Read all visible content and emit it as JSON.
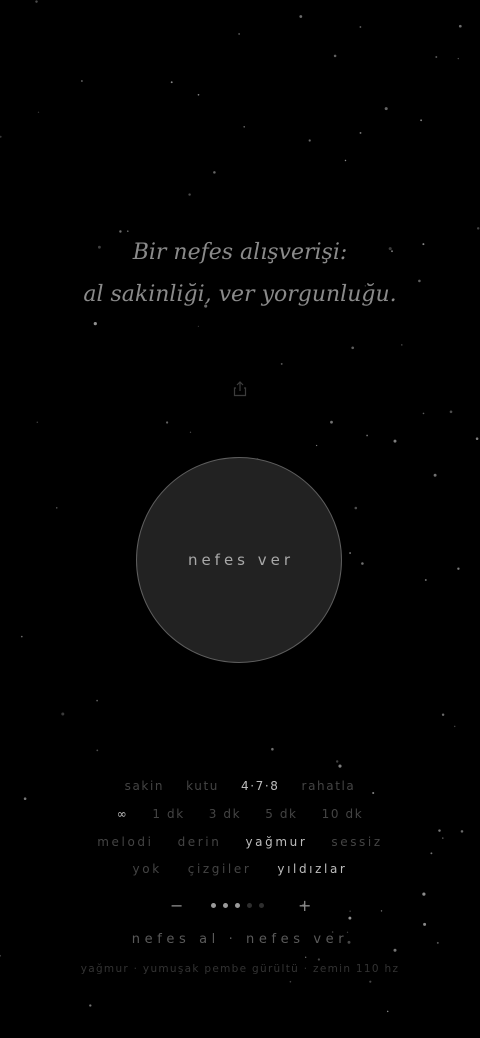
{
  "quote": {
    "line1": "Bir nefes alışverişi:",
    "line2": "al sakinliği, ver yorgunluğu."
  },
  "share": {
    "icon": "share-icon"
  },
  "breath": {
    "label": "nefes ver"
  },
  "pattern_options": [
    {
      "label": "sakin",
      "active": false
    },
    {
      "label": "kutu",
      "active": false
    },
    {
      "label": "4·7·8",
      "active": true
    },
    {
      "label": "rahatla",
      "active": false
    }
  ],
  "duration_options": [
    {
      "label": "∞",
      "active": true
    },
    {
      "label": "1 dk",
      "active": false
    },
    {
      "label": "3 dk",
      "active": false
    },
    {
      "label": "5 dk",
      "active": false
    },
    {
      "label": "10 dk",
      "active": false
    }
  ],
  "sound_options": [
    {
      "label": "melodi",
      "active": false
    },
    {
      "label": "derin",
      "active": false
    },
    {
      "label": "yağmur",
      "active": true
    },
    {
      "label": "sessiz",
      "active": false
    }
  ],
  "visual_options": [
    {
      "label": "yok",
      "active": false
    },
    {
      "label": "çizgiler",
      "active": false
    },
    {
      "label": "yıldızlar",
      "active": true
    }
  ],
  "volume": {
    "minus": "−",
    "plus": "+",
    "level": 3,
    "max": 5
  },
  "status": "nefes al · nefes ver",
  "info": "yağmur · yumuşak pembe gürültü · zemin 110 hz",
  "colors": {
    "background": "#000000",
    "circle_fill": "#222222",
    "circle_border": "#5e5e5e",
    "active_option": "#bdbdbd",
    "inactive_option": "#444444"
  }
}
